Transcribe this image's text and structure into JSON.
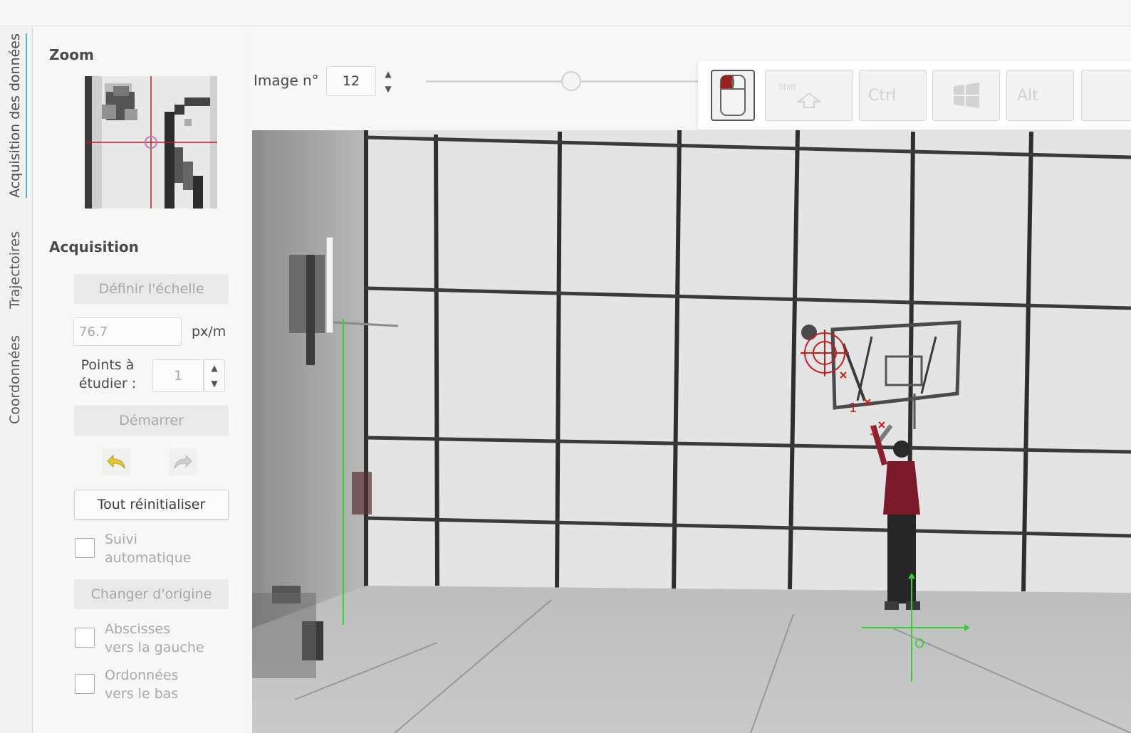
{
  "tabs": {
    "acquisition": "Acquisition des données",
    "trajectoires": "Trajectoires",
    "coordonnees": "Coordonnées"
  },
  "zoom": {
    "title": "Zoom"
  },
  "acquisition": {
    "title": "Acquisition",
    "define_scale_button": "Définir l'échelle",
    "scale_value": "76.7",
    "scale_unit": "px/m",
    "points_label_line1": "Points à",
    "points_label_line2": "étudier :",
    "points_value": "1",
    "start_button": "Démarrer",
    "reset_all_button": "Tout réinitialiser",
    "auto_tracking_line1": "Suivi",
    "auto_tracking_line2": "automatique",
    "auto_tracking_checked": false,
    "change_origin_button": "Changer d'origine",
    "x_left_line1": "Abscisses",
    "x_left_line2": "vers la gauche",
    "x_left_checked": false,
    "y_down_line1": "Ordonnées",
    "y_down_line2": "vers le bas",
    "y_down_checked": false
  },
  "player": {
    "image_label": "Image n°",
    "image_number": "12"
  },
  "keys": {
    "shift_top": "Shift",
    "ctrl": "Ctrl",
    "alt": "Alt"
  },
  "video": {
    "point_label": "1",
    "origin_label": "O"
  },
  "icons": {
    "undo": "undo-arrow-icon",
    "redo": "redo-arrow-icon",
    "mouse": "mouse-left-click-icon",
    "windows": "windows-key-icon",
    "shift": "shift-arrow-icon"
  },
  "colors": {
    "accent_tab": "#5eb0c9",
    "marker_red": "#c81e1e",
    "axis_green": "#3ccc3c"
  }
}
